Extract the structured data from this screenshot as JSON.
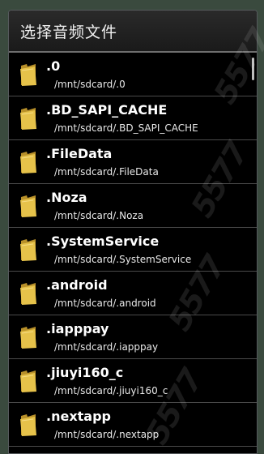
{
  "dialog": {
    "title": "选择音频文件"
  },
  "items": [
    {
      "name": ".0",
      "path": "/mnt/sdcard/.0"
    },
    {
      "name": ".BD_SAPI_CACHE",
      "path": "/mnt/sdcard/.BD_SAPI_CACHE"
    },
    {
      "name": ".FileData",
      "path": "/mnt/sdcard/.FileData"
    },
    {
      "name": ".Noza",
      "path": "/mnt/sdcard/.Noza"
    },
    {
      "name": ".SystemService",
      "path": "/mnt/sdcard/.SystemService"
    },
    {
      "name": ".android",
      "path": "/mnt/sdcard/.android"
    },
    {
      "name": ".iapppay",
      "path": "/mnt/sdcard/.iapppay"
    },
    {
      "name": ".jiuyi160_c",
      "path": "/mnt/sdcard/.jiuyi160_c"
    },
    {
      "name": ".nextapp",
      "path": "/mnt/sdcard/.nextapp"
    }
  ],
  "icon": "folder-icon",
  "watermark": "5577",
  "colors": {
    "folder": "#e6c24a",
    "background": "#000000",
    "divider": "#4a4a4a"
  }
}
